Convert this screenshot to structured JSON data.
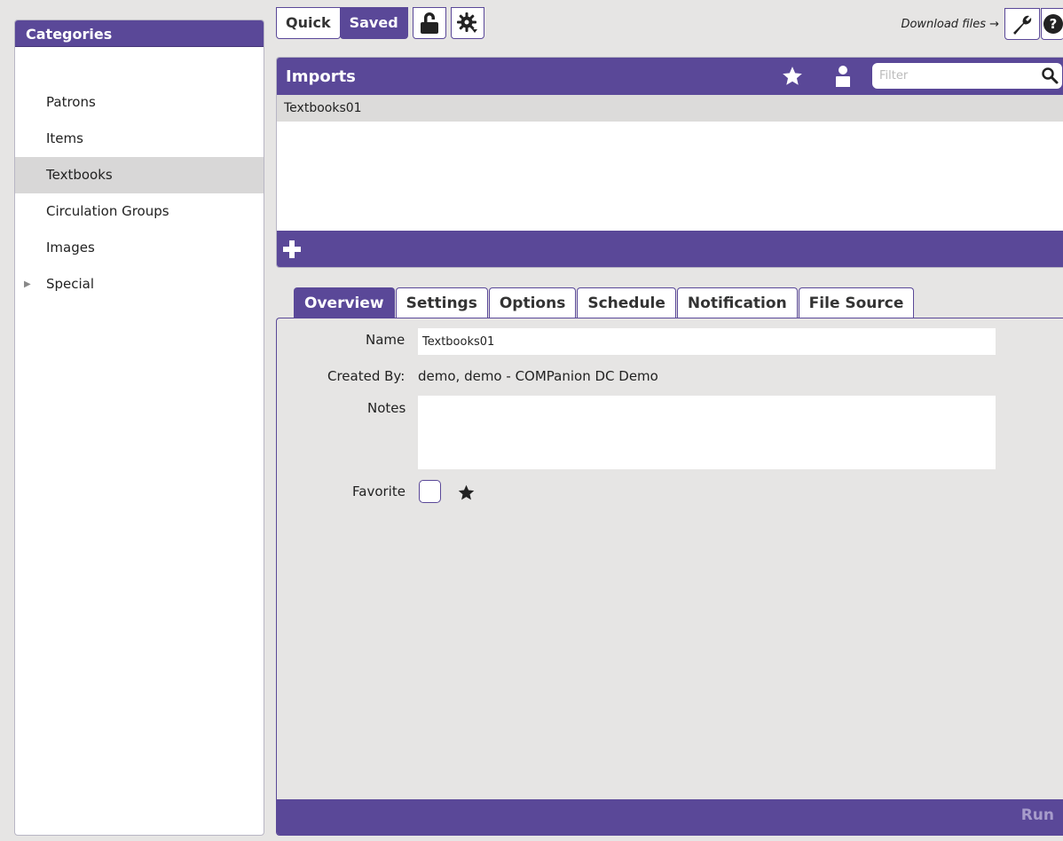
{
  "sidebar": {
    "title": "Categories",
    "items": [
      {
        "label": "Patrons"
      },
      {
        "label": "Items"
      },
      {
        "label": "Textbooks"
      },
      {
        "label": "Circulation Groups"
      },
      {
        "label": "Images"
      },
      {
        "label": "Special"
      }
    ],
    "selected": "Textbooks"
  },
  "toolbar": {
    "quick_label": "Quick",
    "saved_label": "Saved",
    "download_label": "Download files →"
  },
  "imports": {
    "title": "Imports",
    "filter_placeholder": "Filter",
    "rows": [
      {
        "name": "Textbooks01"
      }
    ]
  },
  "tabs": [
    "Overview",
    "Settings",
    "Options",
    "Schedule",
    "Notification",
    "File Source"
  ],
  "active_tab": "Overview",
  "overview": {
    "name_label": "Name",
    "name_value": "Textbooks01",
    "created_by_label": "Created By:",
    "created_by_value": "demo, demo - COMPanion DC Demo",
    "notes_label": "Notes",
    "favorite_label": "Favorite"
  },
  "footer": {
    "run_label": "Run"
  },
  "colors": {
    "accent": "#5a4898",
    "selected_row": "#d8d7d7",
    "background": "#e6e5e4"
  }
}
